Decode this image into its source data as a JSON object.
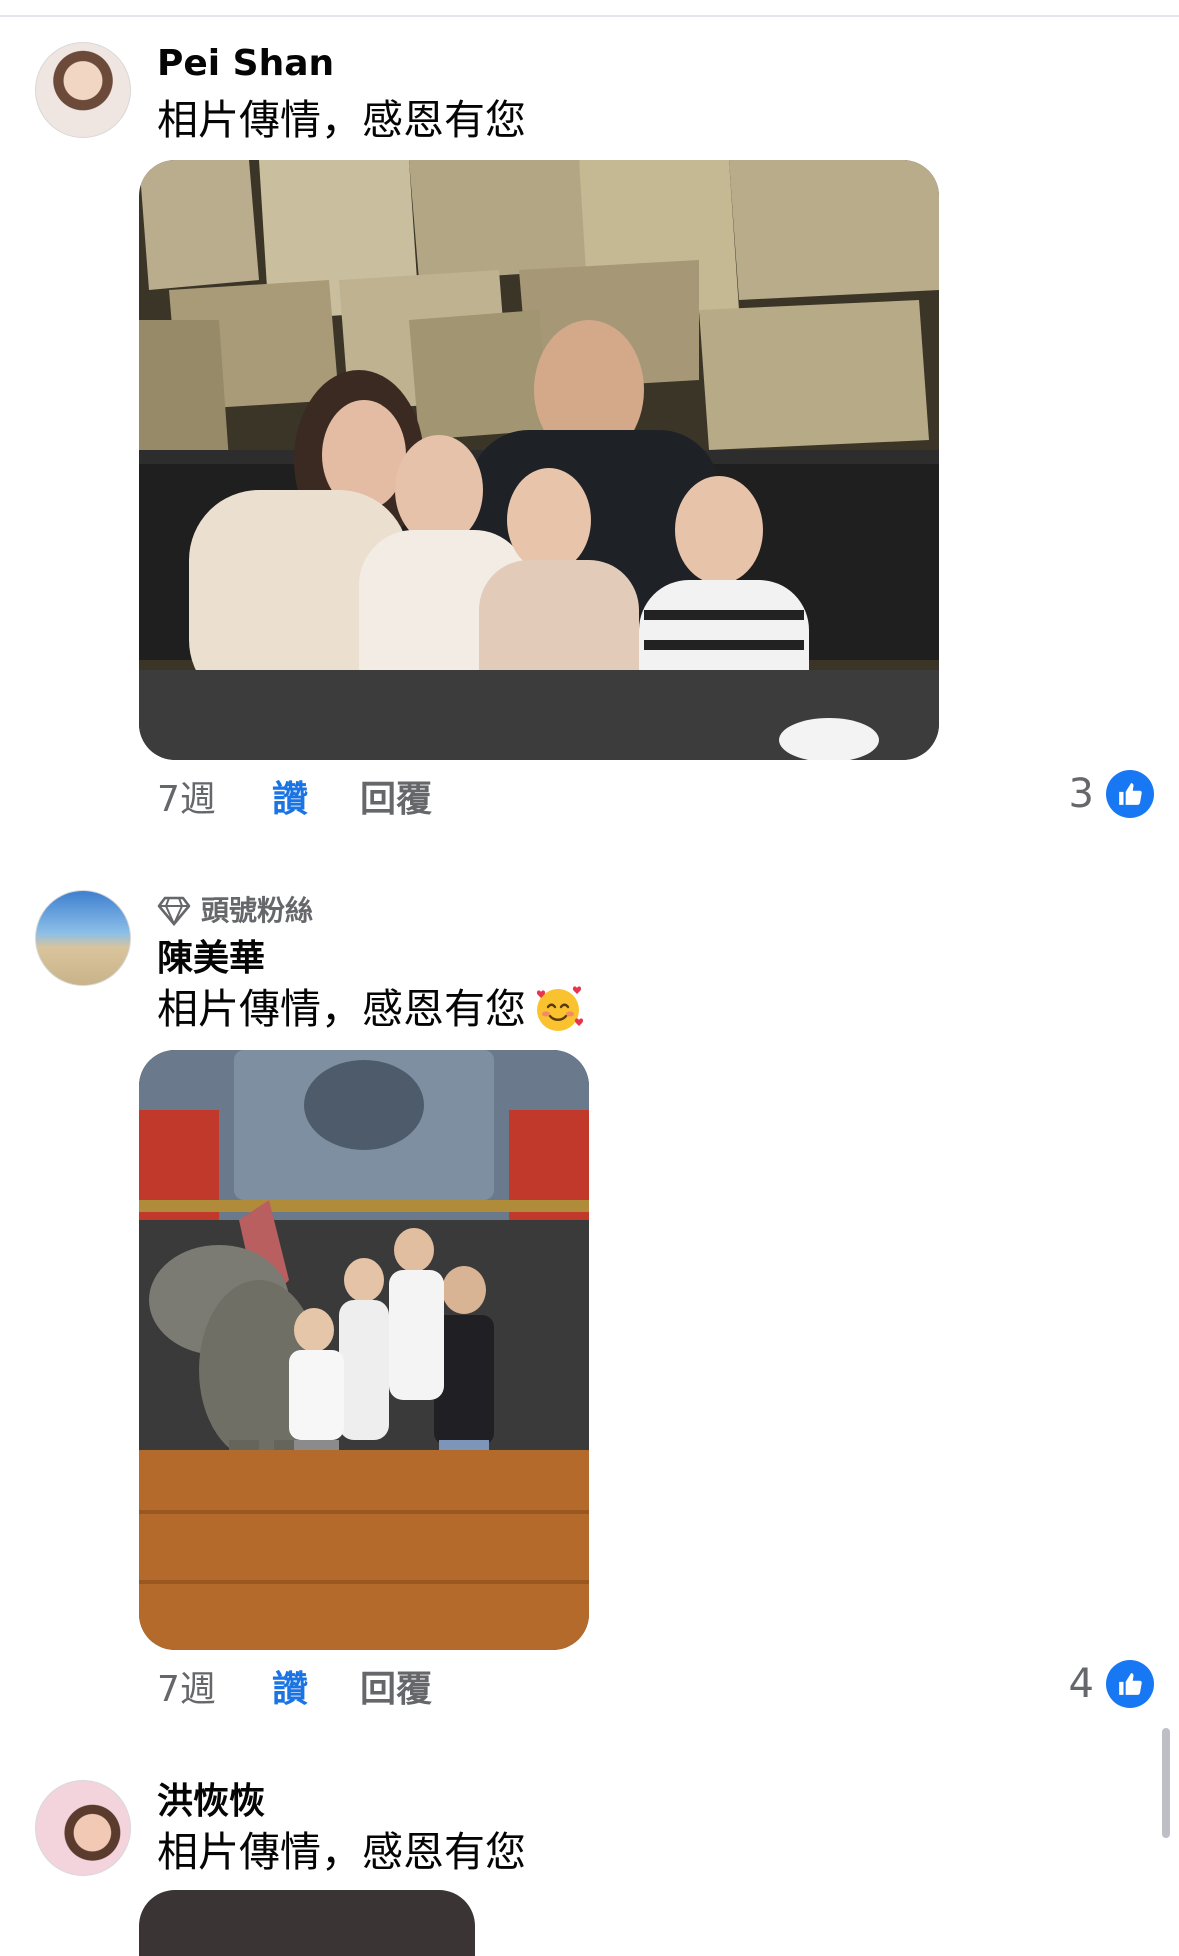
{
  "comments": [
    {
      "author": "Pei Shan",
      "text": "相片傳情，感恩有您",
      "time": "7週",
      "like_label": "讚",
      "reply_label": "回覆",
      "reaction_count": "3",
      "reaction_icon": "like-icon",
      "photo_description_icon": "photo"
    },
    {
      "badge": "頭號粉絲",
      "badge_icon": "diamond-icon",
      "author": "陳美華",
      "text": "相片傳情，感恩有您",
      "emoji": "smiling-face-with-hearts",
      "time": "7週",
      "like_label": "讚",
      "reply_label": "回覆",
      "reaction_count": "4",
      "reaction_icon": "like-icon"
    },
    {
      "author": "洪恢恢",
      "text": "相片傳情，感恩有您"
    }
  ],
  "colors": {
    "accent": "#1b74e4",
    "like_badge": "#1877f2",
    "meta_text": "#65676b",
    "primary_text": "#050505"
  }
}
